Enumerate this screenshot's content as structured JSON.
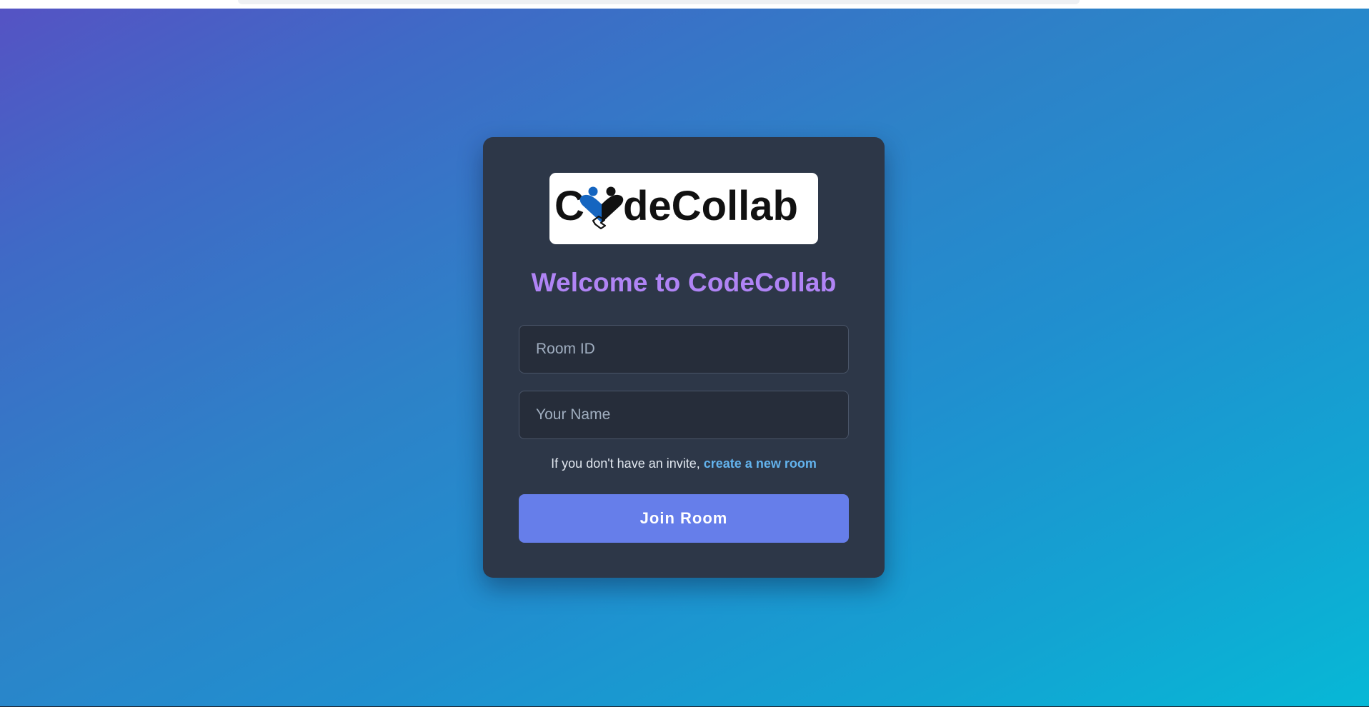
{
  "brand": {
    "logo_text": "CodeCollab",
    "logo_colors": {
      "text": "#111111",
      "accent": "#1565c0"
    }
  },
  "colors": {
    "gradient_start": "#5553c4",
    "gradient_end": "#07b8d6",
    "card_bg": "#2d3748",
    "title": "#b084f5",
    "link": "#63b3ed",
    "button_bg": "#667eea"
  },
  "join_form": {
    "title": "Welcome to CodeCollab",
    "room_id": {
      "value": "",
      "placeholder": "Room ID"
    },
    "name": {
      "value": "",
      "placeholder": "Your Name"
    },
    "invite_text": "If you don't have an invite,",
    "create_link_label": "create a new room",
    "submit_label": "Join Room"
  }
}
